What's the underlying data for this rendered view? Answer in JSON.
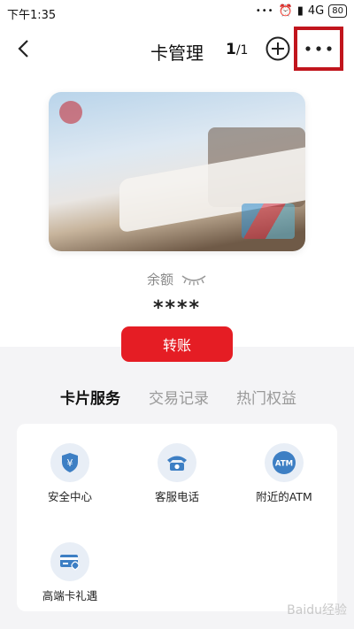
{
  "status_bar": {
    "time": "下午1:35",
    "network": "4G",
    "battery": "80"
  },
  "nav": {
    "title": "卡管理",
    "page_current": "1",
    "page_total": "/1"
  },
  "balance": {
    "label": "余额",
    "value": "****"
  },
  "transfer_button": "转账",
  "tabs": [
    {
      "label": "卡片服务",
      "active": true
    },
    {
      "label": "交易记录",
      "active": false
    },
    {
      "label": "热门权益",
      "active": false
    }
  ],
  "services": [
    {
      "label": "安全中心",
      "icon": "shield-icon"
    },
    {
      "label": "客服电话",
      "icon": "phone-icon"
    },
    {
      "label": "附近的ATM",
      "icon": "atm-icon"
    },
    {
      "label": "高端卡礼遇",
      "icon": "card-gift-icon"
    }
  ],
  "watermark": "Baidu经验",
  "colors": {
    "accent": "#e51d24",
    "highlight_box": "#c1151d",
    "icon_blue": "#3d7fc4"
  }
}
